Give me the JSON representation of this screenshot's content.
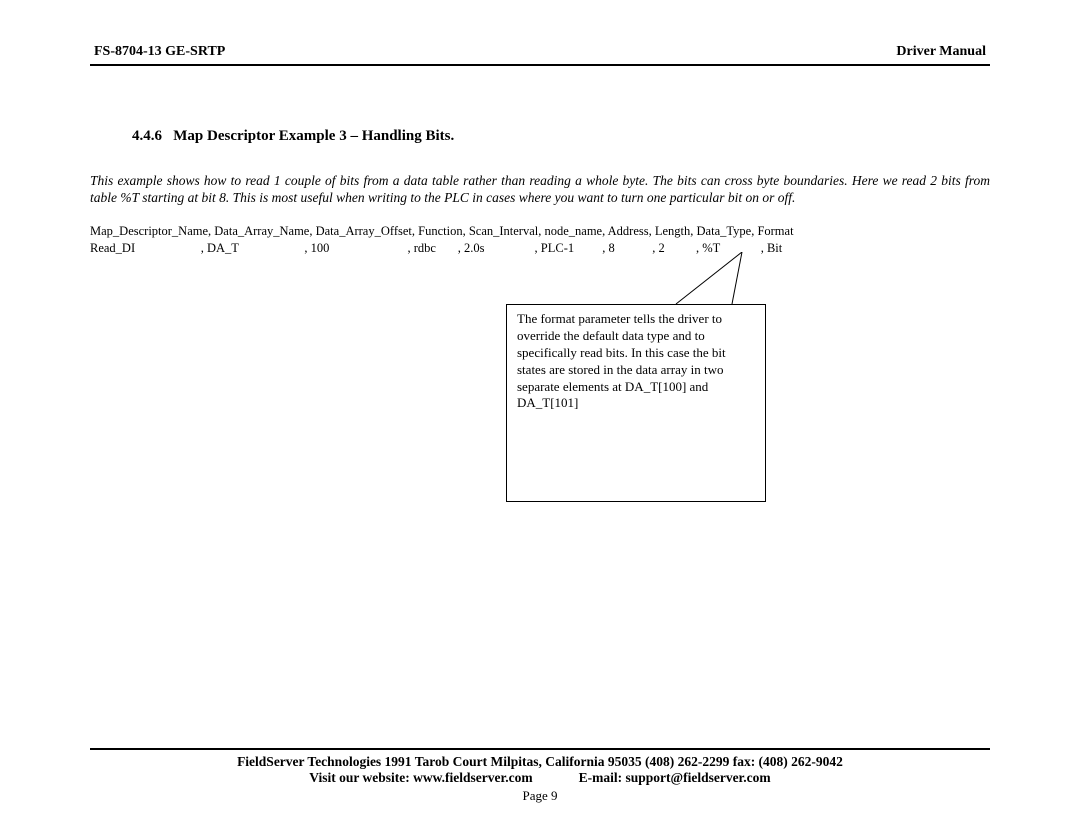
{
  "header": {
    "left": "FS-8704-13 GE-SRTP",
    "right": "Driver Manual"
  },
  "section": {
    "number": "4.4.6",
    "title": "Map Descriptor Example 3 – Handling Bits."
  },
  "intro": "This example shows how to read 1 couple of bits from a data table rather than reading a whole byte. The bits can cross byte boundaries.  Here we read 2 bits from table %T starting at bit 8. This is most useful when writing to the PLC in cases where you want to turn one particular bit on or off.",
  "table": {
    "headers": "Map_Descriptor_Name, Data_Array_Name, Data_Array_Offset, Function, Scan_Interval, node_name, Address, Length, Data_Type, Format",
    "row": "Read_DI                     , DA_T                     , 100                         , rdbc       , 2.0s                , PLC-1         , 8            , 2          , %T             , Bit"
  },
  "callout": "The format parameter tells the driver to override the default data type and to specifically read bits. In this case the bit states are stored in the data array in two separate elements at DA_T[100] and DA_T[101]",
  "footer": {
    "address": "FieldServer Technologies 1991 Tarob Court Milpitas, California 95035 (408) 262-2299 fax: (408) 262-9042",
    "website_label": "Visit our website: www.fieldserver.com",
    "email_label": "E-mail: support@fieldserver.com",
    "page": "Page 9"
  }
}
